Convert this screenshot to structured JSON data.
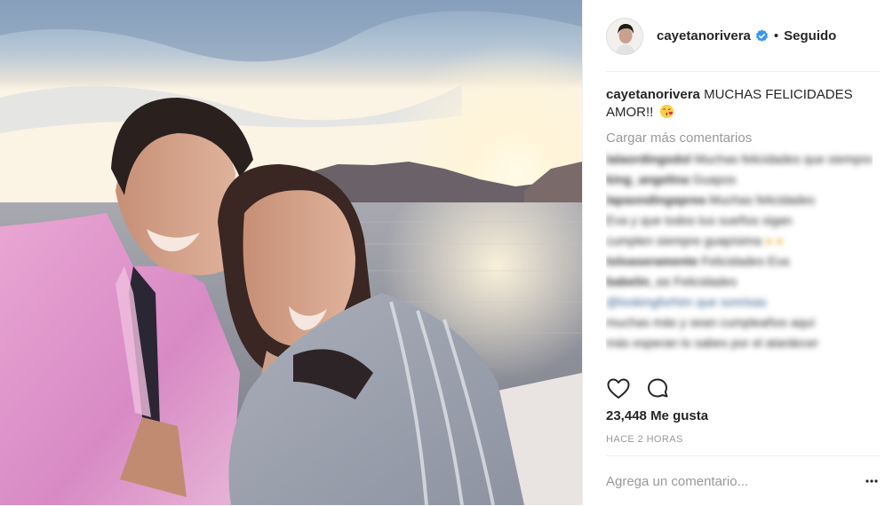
{
  "post": {
    "photo_alt": "selfie at sunset on a boat"
  },
  "header": {
    "username": "cayetanorivera",
    "dot": "•",
    "follow_label": "Seguido"
  },
  "caption": {
    "username": "cayetanorivera",
    "text": "MUCHAS FELICIDADES AMOR!!"
  },
  "comments": {
    "load_more_label": "Cargar más comentarios",
    "blurred": [
      {
        "user": "lalaordingsdol",
        "text": "Muchas felicidades que siempre más preciosa"
      },
      {
        "user": "king_angelina",
        "text": "Guapos"
      },
      {
        "user": "lapaondingaprea",
        "text": "Muchas felicidades"
      },
      {
        "user": "",
        "text": "Eva y que todos tus sueños sigan"
      },
      {
        "user": "",
        "text": "cumplen siempre guapísima"
      },
      {
        "user": "toloaseramente",
        "text": "Felicidades Eva"
      },
      {
        "user": "babelin_cc",
        "text": "Felicidades"
      },
      {
        "user": "",
        "text": "@lookingforhim que sonrisas"
      },
      {
        "user": "",
        "text": "muchas más y sean cumpleaños aquí"
      },
      {
        "user": "",
        "text": "más esperan lo sabes por el atardecer"
      }
    ]
  },
  "likes": {
    "count": "23,448",
    "label": "Me gusta"
  },
  "time": "HACE 2 HORAS",
  "comment_input": {
    "placeholder": "Agrega un comentario..."
  },
  "colors": {
    "text": "#262626",
    "muted": "#999999",
    "border": "#efefef",
    "verified": "#3897f0",
    "link": "#003569"
  }
}
